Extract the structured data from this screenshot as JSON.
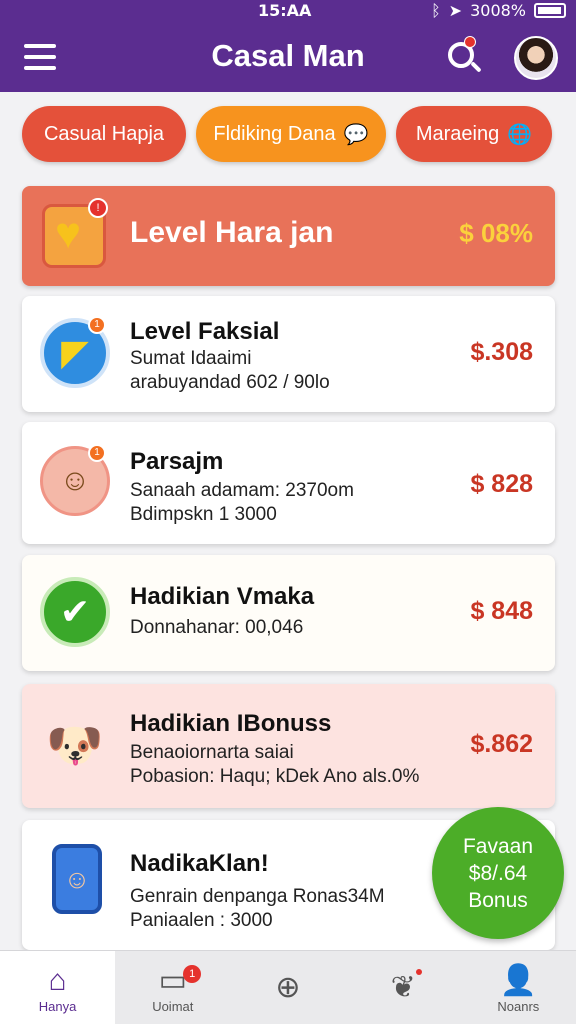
{
  "status": {
    "time": "15:AA",
    "battery": "3008%"
  },
  "header": {
    "title": "Casal Man"
  },
  "chips": [
    {
      "label": "Casual Hapja"
    },
    {
      "label": "Fldiking Dana"
    },
    {
      "label": "Maraeing"
    }
  ],
  "banner": {
    "title": "Level Hara jan",
    "value": "$ 08%"
  },
  "cards": [
    {
      "title": "Level Faksial",
      "line1": "Sumat Idaaimi",
      "line2": "arabuyandad 602 / 90lo",
      "price": "$.308"
    },
    {
      "title": "Parsajm",
      "line1": "Sanaah adamam: 2370om",
      "line2": "Bdimpskn 1 3000",
      "price": "$ 828"
    },
    {
      "title": "Hadikian Vmaka",
      "line1": "Donnahanar: 00,046",
      "price": "$ 848"
    },
    {
      "title": "Hadikian IBonuss",
      "line1": "Benaoiornarta saiai",
      "line2": "Pobasion: Haqu; kDek Ano als.0%",
      "price": "$.862"
    },
    {
      "title": "NadikaKlan!",
      "line1": "Genrain denpanga Ronas34M",
      "line2": "Paniaalen : 3000"
    }
  ],
  "fab": {
    "line1": "Favaan",
    "line2": "$8/.64",
    "line3": "Bonus"
  },
  "nav": [
    {
      "label": "Hanya",
      "icon": "home-icon"
    },
    {
      "label": "Uoimat",
      "icon": "inbox-icon",
      "badge": "1"
    },
    {
      "label": "",
      "icon": "add-circle-icon"
    },
    {
      "label": "",
      "icon": "leaf-icon"
    },
    {
      "label": "Noanrs",
      "icon": "profile-icon"
    }
  ],
  "colors": {
    "primary": "#5b2d90",
    "chip_red": "#e4513a",
    "chip_orange": "#f7931e",
    "banner": "#e87259",
    "price": "#c93624",
    "fab": "#4cad28"
  }
}
